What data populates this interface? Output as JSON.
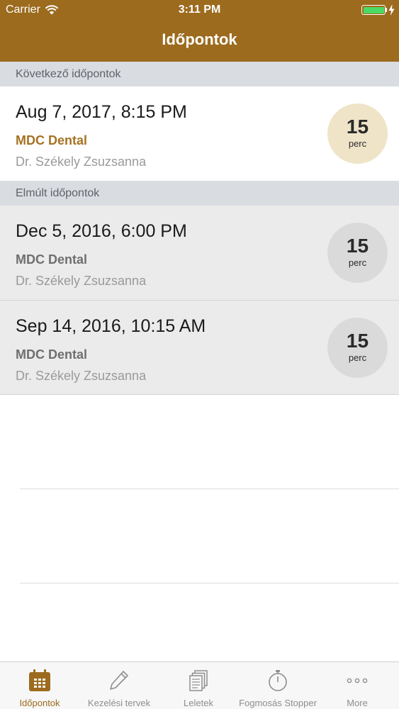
{
  "status_bar": {
    "carrier": "Carrier",
    "time": "3:11 PM"
  },
  "nav": {
    "title": "Időpontok"
  },
  "sections": {
    "upcoming": "Következő időpontok",
    "past": "Elmúlt időpontok"
  },
  "appointments": [
    {
      "date": "Aug 7, 2017, 8:15 PM",
      "clinic": "MDC Dental",
      "doctor": "Dr. Székely Zsuzsanna",
      "duration": "15",
      "unit": "perc"
    },
    {
      "date": "Dec 5, 2016, 6:00 PM",
      "clinic": "MDC Dental",
      "doctor": "Dr. Székely Zsuzsanna",
      "duration": "15",
      "unit": "perc"
    },
    {
      "date": "Sep 14, 2016, 10:15 AM",
      "clinic": "MDC Dental",
      "doctor": "Dr. Székely Zsuzsanna",
      "duration": "15",
      "unit": "perc"
    }
  ],
  "tabs": [
    {
      "label": "Időpontok",
      "icon": "calendar-icon",
      "active": true
    },
    {
      "label": "Kezelési tervek",
      "icon": "pencil-icon",
      "active": false
    },
    {
      "label": "Leletek",
      "icon": "documents-icon",
      "active": false
    },
    {
      "label": "Fogmosás Stopper",
      "icon": "stopwatch-icon",
      "active": false
    },
    {
      "label": "More",
      "icon": "more-dots-icon",
      "active": false
    }
  ],
  "colors": {
    "brand": "#9c6b1e",
    "battery": "#4cd964"
  }
}
